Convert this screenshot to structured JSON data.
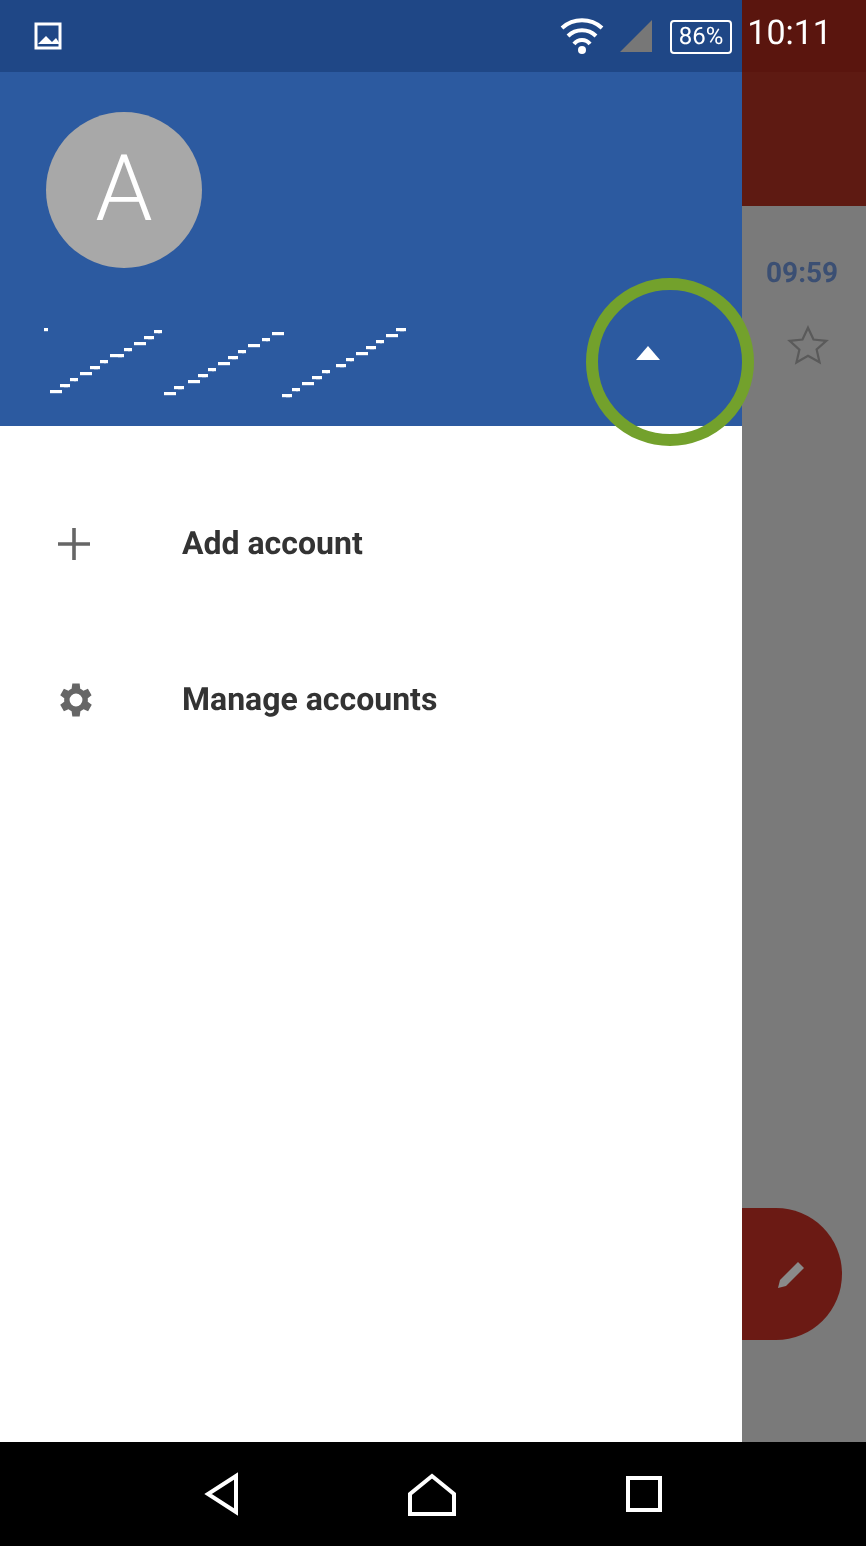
{
  "status_bar": {
    "battery": "86%",
    "time": "10:11"
  },
  "drawer": {
    "avatar_letter": "A",
    "account_list_expanded": true,
    "items": [
      {
        "kind": "add",
        "label": "Add account"
      },
      {
        "kind": "manage",
        "label": "Manage accounts"
      }
    ]
  },
  "background": {
    "message_time": "09:59"
  }
}
